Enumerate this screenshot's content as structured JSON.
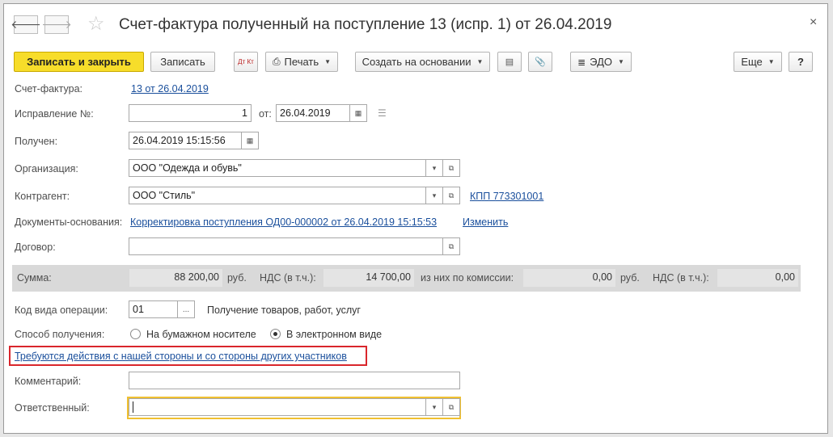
{
  "window": {
    "title": "Счет-фактура полученный на поступление 13 (испр. 1) от 26.04.2019",
    "close_glyph": "×",
    "back_glyph": "🡐",
    "forward_glyph": "🡒",
    "star_glyph": "☆"
  },
  "toolbar": {
    "save_close_label": "Записать и закрыть",
    "save_label": "Записать",
    "dtkt_label": "Дт Кт",
    "print_label": "Печать",
    "create_based_label": "Создать на основании",
    "edo_label": "ЭДО",
    "more_label": "Еще",
    "help_label": "?"
  },
  "form": {
    "invoice_label": "Счет-фактура:",
    "invoice_link": "13 от 26.04.2019",
    "correction_label": "Исправление №:",
    "correction_value": "1",
    "from_label": "от:",
    "from_date": "26.04.2019",
    "received_label": "Получен:",
    "received_value": "26.04.2019 15:15:56",
    "org_label": "Организация:",
    "org_value": "ООО \"Одежда и обувь\"",
    "counterparty_label": "Контрагент:",
    "counterparty_value": "ООО \"Стиль\"",
    "kpp_link": "КПП 773301001",
    "basis_label": "Документы-основания:",
    "basis_link": "Корректировка поступления ОД00-000002 от 26.04.2019 15:15:53",
    "change_link": "Изменить",
    "contract_label": "Договор:",
    "contract_value": ""
  },
  "sum": {
    "label": "Сумма:",
    "amount": "88 200,00",
    "currency1": "руб.",
    "vat_label1": "НДС (в т.ч.):",
    "vat_amount1": "14 700,00",
    "commission_label": "из них по комиссии:",
    "commission_amount": "0,00",
    "currency2": "руб.",
    "vat_label2": "НДС (в т.ч.):",
    "vat_amount2": "0,00"
  },
  "operation": {
    "code_label": "Код вида операции:",
    "code_value": "01",
    "ellipsis": "...",
    "code_desc": "Получение товаров, работ, услуг"
  },
  "receipt": {
    "label": "Способ получения:",
    "option_paper": "На бумажном носителе",
    "option_electronic": "В электронном виде",
    "selected": "В электронном виде"
  },
  "action_link": "Требуются действия с нашей стороны и со стороны других участников",
  "comment": {
    "label": "Комментарий:",
    "value": ""
  },
  "responsible": {
    "label": "Ответственный:",
    "value": ""
  }
}
